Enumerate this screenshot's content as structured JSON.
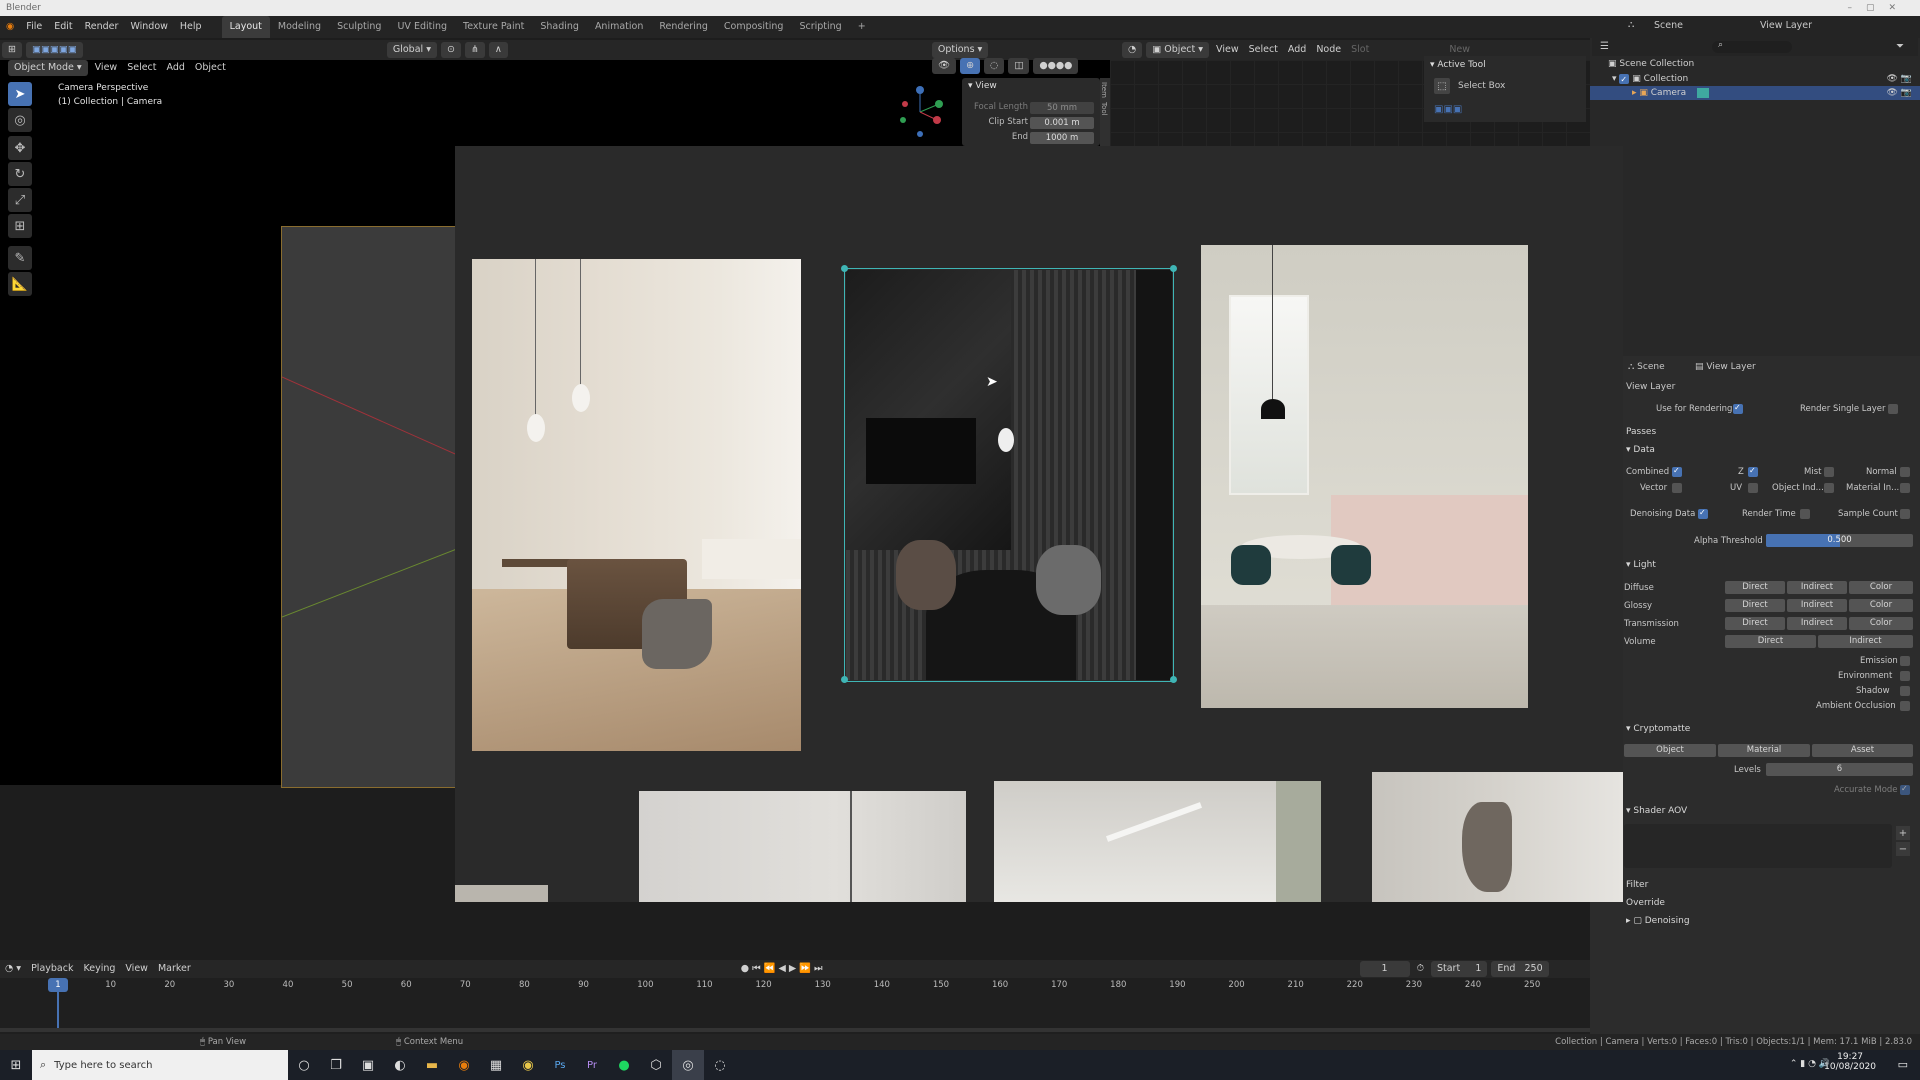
{
  "window": {
    "title": "Blender"
  },
  "menu": {
    "items": [
      "File",
      "Edit",
      "Render",
      "Window",
      "Help"
    ],
    "workspaces": [
      "Layout",
      "Modeling",
      "Sculpting",
      "UV Editing",
      "Texture Paint",
      "Shading",
      "Animation",
      "Rendering",
      "Compositing",
      "Scripting"
    ],
    "active_workspace": "Layout",
    "add": "+"
  },
  "outliner_header": {
    "scene": "Scene",
    "view_layer": "View Layer"
  },
  "viewport_header": {
    "mode": "Object Mode",
    "menus": [
      "View",
      "Select",
      "Add",
      "Object"
    ],
    "orientation": "Global",
    "options": "Options"
  },
  "viewport": {
    "line1": "Camera Perspective",
    "line2": "(1) Collection | Camera"
  },
  "npanel": {
    "section": "View",
    "focal_label": "Focal Length",
    "focal_value": "50 mm",
    "clip_start_label": "Clip Start",
    "clip_start_value": "0.001 m",
    "end_label": "End",
    "end_value": "1000 m",
    "tabs": [
      "Item",
      "Tool",
      "View"
    ]
  },
  "node_header": {
    "object": "Object",
    "menus": [
      "View",
      "Select",
      "Add",
      "Node"
    ],
    "slot": "Slot",
    "new": "New"
  },
  "active_tool": {
    "title": "Active Tool",
    "tool": "Select Box"
  },
  "outliner": {
    "scene_collection": "Scene Collection",
    "collection": "Collection",
    "camera": "Camera"
  },
  "props": {
    "tab_scene": "Scene",
    "tab_view_layer": "View Layer",
    "section_view_layer": "View Layer",
    "use_for_rendering": "Use for Rendering",
    "render_single_layer": "Render Single Layer",
    "passes": "Passes",
    "data": "Data",
    "combined": "Combined",
    "z": "Z",
    "mist": "Mist",
    "normal": "Normal",
    "vector": "Vector",
    "uv": "UV",
    "object_index": "Object Ind...",
    "material_index": "Material In...",
    "denoising_data": "Denoising Data",
    "render_time": "Render Time",
    "sample_count": "Sample Count",
    "alpha_threshold_label": "Alpha Threshold",
    "alpha_threshold_value": "0.500",
    "alpha_threshold": 0.5,
    "light": "Light",
    "light_rows": [
      "Diffuse",
      "Glossy",
      "Transmission",
      "Volume"
    ],
    "direct": "Direct",
    "indirect": "Indirect",
    "color": "Color",
    "emission": "Emission",
    "environment": "Environment",
    "shadow": "Shadow",
    "ambient_occlusion": "Ambient Occlusion",
    "cryptomatte": "Cryptomatte",
    "crypto_object": "Object",
    "crypto_material": "Material",
    "crypto_asset": "Asset",
    "levels_label": "Levels",
    "levels_value": "6",
    "accurate_mode": "Accurate Mode",
    "shader_aov": "Shader AOV",
    "filter": "Filter",
    "override": "Override",
    "denoising": "Denoising"
  },
  "timeline": {
    "menus": [
      "Playback",
      "Keying",
      "View",
      "Marker"
    ],
    "current_frame": "1",
    "start_label": "Start",
    "start_value": "1",
    "end_label": "End",
    "end_value": "250",
    "ticks": [
      "10",
      "20",
      "30",
      "40",
      "50",
      "60",
      "70",
      "80",
      "90",
      "100",
      "110",
      "120",
      "130",
      "140",
      "150",
      "160",
      "170",
      "180",
      "190",
      "200",
      "210",
      "220",
      "230",
      "240",
      "250"
    ],
    "playhead": "1"
  },
  "status": {
    "pan_view": "Pan View",
    "context_menu": "Context Menu",
    "stats": "Collection | Camera | Verts:0 | Faces:0 | Tris:0 | Objects:1/1 | Mem: 17.1 MiB | 2.83.0"
  },
  "taskbar": {
    "search_placeholder": "Type here to search",
    "time": "19:27",
    "date": "10/08/2020"
  },
  "colors": {
    "accent": "#4772b3",
    "selection": "#3fb5b5",
    "bg": "#1d1d1d"
  }
}
